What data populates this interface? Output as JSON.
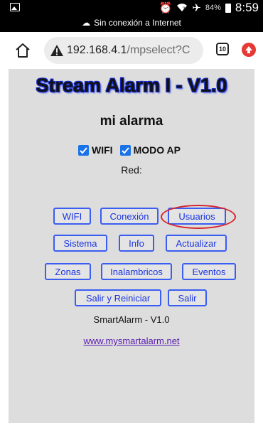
{
  "status": {
    "battery": "84%",
    "time": "8:59",
    "offline": "Sin conexión a Internet"
  },
  "browser": {
    "url_host": "192.168.4.1",
    "url_path": "/mpselect?C",
    "tabs_count": "10"
  },
  "page": {
    "title": "Stream Alarm I - V1.0",
    "device_name": "mi alarma",
    "checkboxes": [
      {
        "label": "WIFI",
        "checked": true
      },
      {
        "label": "MODO AP",
        "checked": true
      }
    ],
    "red_label": "Red:",
    "buttons": {
      "wifi": "WIFI",
      "conexion": "Conexión",
      "usuarios": "Usuarios",
      "sistema": "Sistema",
      "info": "Info",
      "actualizar": "Actualizar",
      "zonas": "Zonas",
      "inalambricos": "Inalambricos",
      "eventos": "Eventos",
      "salir_reiniciar": "Salir y Reiniciar",
      "salir": "Salir"
    },
    "footer_text": "SmartAlarm - V1.0",
    "footer_link": "www.mysmartalarm.net"
  },
  "colors": {
    "accent_blue": "#3a5df2",
    "highlight_red": "#d9252d",
    "page_bg": "#dddddd"
  }
}
